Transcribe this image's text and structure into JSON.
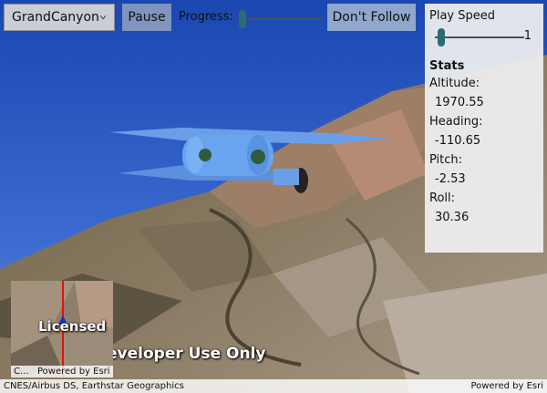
{
  "scene_selector": {
    "selected": "GrandCanyon",
    "icon": "chevron-down-icon"
  },
  "toolbar": {
    "pause_label": "Pause",
    "progress_label": "Progress:",
    "progress_value": 0.02,
    "follow_label": "Don't Follow"
  },
  "panel": {
    "play_speed_label": "Play Speed",
    "play_speed_value": "1",
    "stats_title": "Stats",
    "stats": [
      {
        "label": "Altitude:",
        "value": "1970.55"
      },
      {
        "label": "Heading:",
        "value": "-110.65"
      },
      {
        "label": "Pitch:",
        "value": "-2.53"
      },
      {
        "label": "Roll:",
        "value": "30.36"
      }
    ]
  },
  "overlay": {
    "watermark": "For Developer Use Only",
    "minimap_licensed": "Licensed",
    "minimap_attribution_short": "C...",
    "minimap_powered": "Powered by Esri"
  },
  "attribution": {
    "left": "CNES/Airbus DS, Earthstar Geographics",
    "right": "Powered by Esri"
  },
  "colors": {
    "sky": "#2a56b8",
    "plane": "#6a9fe8",
    "panel": "#f0f0f0"
  }
}
